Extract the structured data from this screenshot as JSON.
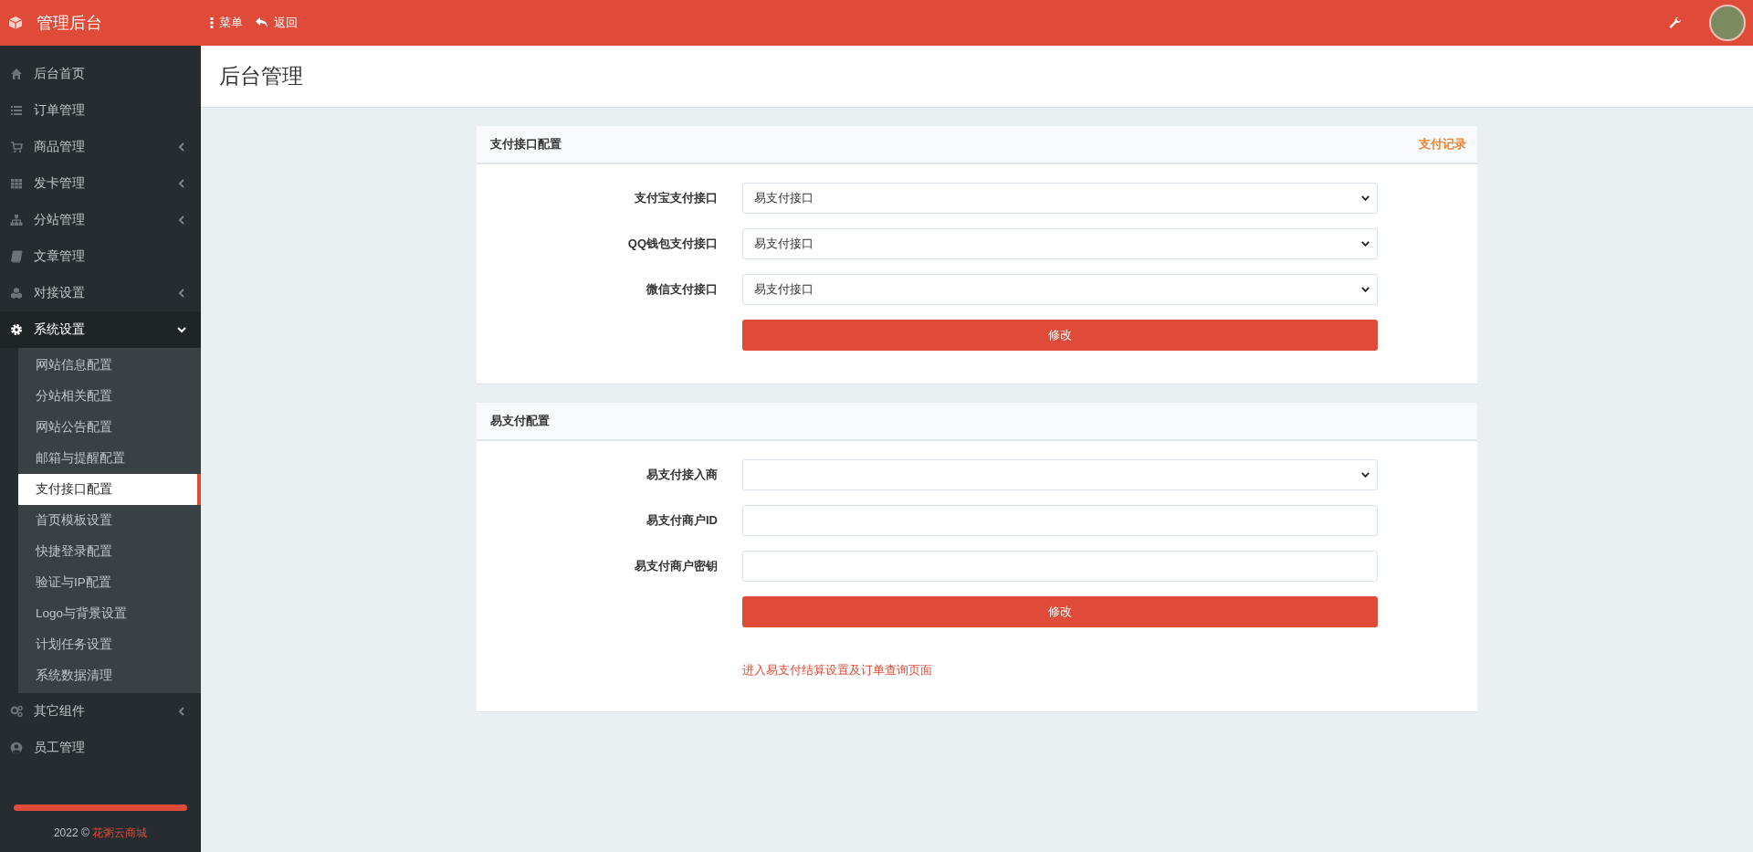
{
  "topbar": {
    "title": "管理后台",
    "actions": [
      {
        "kind": "menu",
        "label": "菜单"
      },
      {
        "kind": "back",
        "label": "返回"
      }
    ]
  },
  "sidebar": {
    "items": [
      {
        "label": "后台首页",
        "has_arrow": false,
        "expanded": false
      },
      {
        "label": "订单管理",
        "has_arrow": false,
        "expanded": false
      },
      {
        "label": "商品管理",
        "has_arrow": true,
        "expanded": false
      },
      {
        "label": "发卡管理",
        "has_arrow": true,
        "expanded": false
      },
      {
        "label": "分站管理",
        "has_arrow": true,
        "expanded": false
      },
      {
        "label": "文章管理",
        "has_arrow": false,
        "expanded": false
      },
      {
        "label": "对接设置",
        "has_arrow": true,
        "expanded": false
      },
      {
        "label": "系统设置",
        "has_arrow": true,
        "expanded": true,
        "children": [
          {
            "label": "网站信息配置",
            "selected": false
          },
          {
            "label": "分站相关配置",
            "selected": false
          },
          {
            "label": "网站公告配置",
            "selected": false
          },
          {
            "label": "邮箱与提醒配置",
            "selected": false
          },
          {
            "label": "支付接口配置",
            "selected": true
          },
          {
            "label": "首页模板设置",
            "selected": false
          },
          {
            "label": "快捷登录配置",
            "selected": false
          },
          {
            "label": "验证与IP配置",
            "selected": false
          },
          {
            "label": "Logo与背景设置",
            "selected": false
          },
          {
            "label": "计划任务设置",
            "selected": false
          },
          {
            "label": "系统数据清理",
            "selected": false
          }
        ]
      },
      {
        "label": "其它组件",
        "has_arrow": true,
        "expanded": false
      },
      {
        "label": "员工管理",
        "has_arrow": false,
        "expanded": false
      }
    ],
    "footer": {
      "year": "2022 ©",
      "brand": "花粥云商城"
    }
  },
  "page_title": "后台管理",
  "panels": [
    {
      "title": "支付接口配置",
      "link": "支付记录",
      "fields": [
        {
          "label": "支付宝支付接口",
          "kind": "select",
          "value": "易支付接口"
        },
        {
          "label": "QQ钱包支付接口",
          "kind": "select",
          "value": "易支付接口"
        },
        {
          "label": "微信支付接口",
          "kind": "select",
          "value": "易支付接口"
        }
      ],
      "button": "修改"
    },
    {
      "title": "易支付配置",
      "fields": [
        {
          "label": "易支付接入商",
          "kind": "select"
        },
        {
          "label": "易支付商户ID",
          "kind": "text"
        },
        {
          "label": "易支付商户密钥",
          "kind": "text"
        }
      ],
      "button": "修改",
      "footer_link": "进入易支付结算设置及订单查询页面"
    }
  ]
}
